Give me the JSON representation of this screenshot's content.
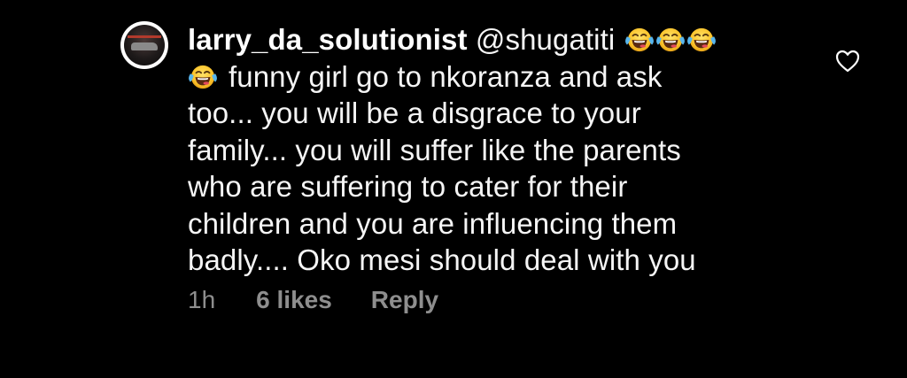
{
  "comment": {
    "username": "larry_da_solutionist",
    "mention": "@shugatiti",
    "emoji_icon": "face-with-tears-of-joy-icon",
    "emoji_count": 4,
    "lines": [
      "funny girl go to nkoranza and ask",
      "too... you will be a disgrace to your",
      "family... you will suffer like the parents",
      "who are suffering to cater for their",
      "children and you are influencing them",
      "badly.... Oko mesi should deal with you"
    ],
    "time": "1h",
    "likes": "6 likes",
    "reply_label": "Reply",
    "like_icon": "heart-outline-icon"
  },
  "colors": {
    "background": "#000000",
    "text": "#f5f5f5",
    "meta": "#8e8e8e"
  }
}
